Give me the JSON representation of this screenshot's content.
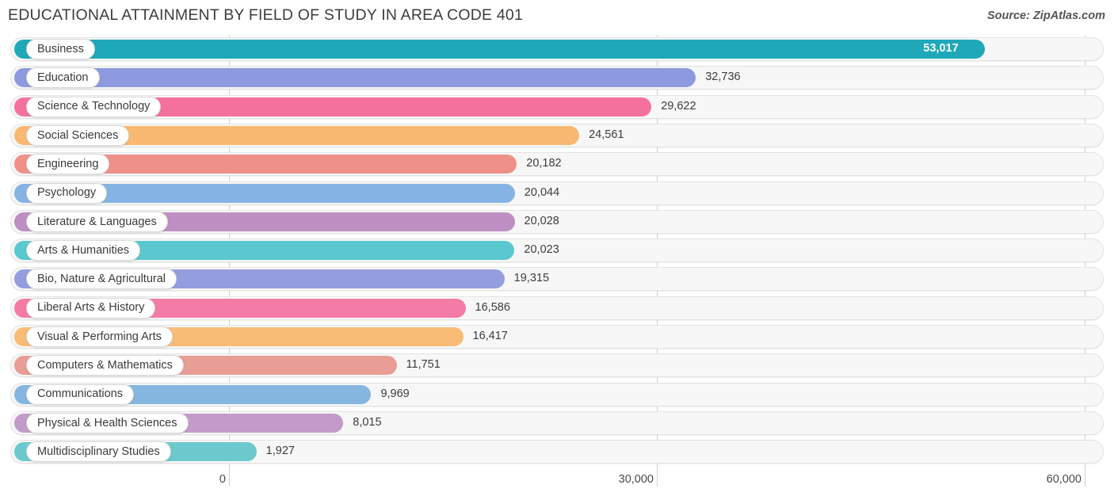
{
  "header": {
    "title": "EDUCATIONAL ATTAINMENT BY FIELD OF STUDY IN AREA CODE 401",
    "source": "Source: ZipAtlas.com"
  },
  "chart_data": {
    "type": "bar",
    "orientation": "horizontal",
    "title": "EDUCATIONAL ATTAINMENT BY FIELD OF STUDY IN AREA CODE 401",
    "xlabel": "",
    "ylabel": "",
    "xlim": [
      0,
      60000
    ],
    "grid": true,
    "legend": false,
    "x_ticks": [
      {
        "label": "0",
        "value": 0
      },
      {
        "label": "30,000",
        "value": 30000
      },
      {
        "label": "60,000",
        "value": 60000
      }
    ],
    "categories": [
      "Business",
      "Education",
      "Science & Technology",
      "Social Sciences",
      "Engineering",
      "Psychology",
      "Literature & Languages",
      "Arts & Humanities",
      "Bio, Nature & Agricultural",
      "Liberal Arts & History",
      "Visual & Performing Arts",
      "Computers & Mathematics",
      "Communications",
      "Physical & Health Sciences",
      "Multidisciplinary Studies"
    ],
    "values": [
      53017,
      32736,
      29622,
      24561,
      20182,
      20044,
      20028,
      20023,
      19315,
      16586,
      16417,
      11751,
      9969,
      8015,
      1927
    ],
    "value_labels": [
      "53,017",
      "32,736",
      "29,622",
      "24,561",
      "20,182",
      "20,044",
      "20,028",
      "20,023",
      "19,315",
      "16,586",
      "16,417",
      "11,751",
      "9,969",
      "8,015",
      "1,927"
    ],
    "colors": [
      "#1fa9b8",
      "#8e9ae0",
      "#f4719e",
      "#f9b972",
      "#ef9189",
      "#85b3e3",
      "#bd8fc2",
      "#5ac8cf",
      "#949ede",
      "#f47ba6",
      "#f9bc77",
      "#e89d95",
      "#85b6e0",
      "#c29bc8",
      "#6cc9cd"
    ]
  },
  "axis": {
    "tick_labels": [
      "0",
      "30,000",
      "60,000"
    ]
  }
}
